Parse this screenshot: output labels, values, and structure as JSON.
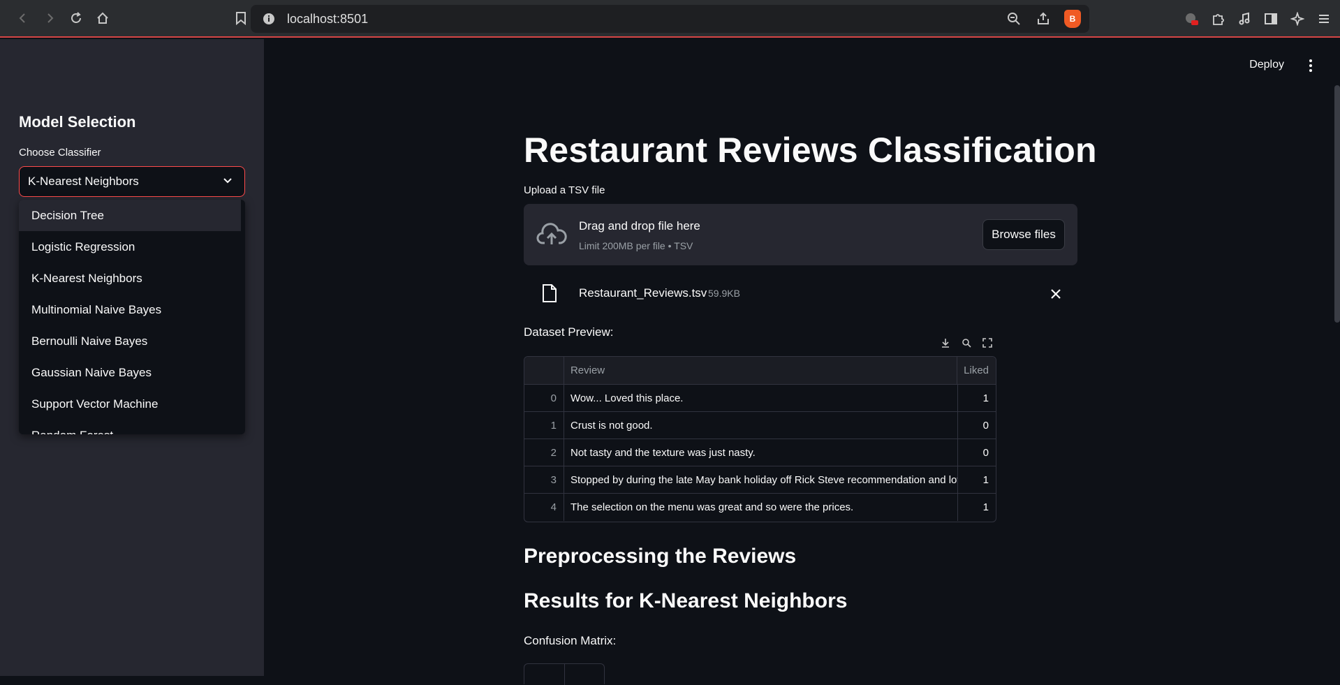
{
  "browser": {
    "url": "localhost:8501"
  },
  "sidebar": {
    "title": "Model Selection",
    "select_label": "Choose Classifier",
    "selected": "K-Nearest Neighbors",
    "options": [
      "Decision Tree",
      "Logistic Regression",
      "K-Nearest Neighbors",
      "Multinomial Naive Bayes",
      "Bernoulli Naive Bayes",
      "Gaussian Naive Bayes",
      "Support Vector Machine",
      "Random Forest"
    ]
  },
  "header": {
    "deploy_label": "Deploy"
  },
  "main": {
    "title": "Restaurant Reviews Classification",
    "upload_label": "Upload a TSV file",
    "dropzone_text": "Drag and drop file here",
    "dropzone_limit": "Limit 200MB per file • TSV",
    "browse_label": "Browse files",
    "file_name": "Restaurant_Reviews.tsv",
    "file_size": "59.9KB",
    "preview_label": "Dataset Preview:",
    "table": {
      "columns": [
        "",
        "Review",
        "Liked"
      ],
      "rows": [
        {
          "idx": "0",
          "review": "Wow... Loved this place.",
          "liked": "1"
        },
        {
          "idx": "1",
          "review": "Crust is not good.",
          "liked": "0"
        },
        {
          "idx": "2",
          "review": "Not tasty and the texture was just nasty.",
          "liked": "0"
        },
        {
          "idx": "3",
          "review": "Stopped by during the late May bank holiday off Rick Steve recommendation and love",
          "liked": "1"
        },
        {
          "idx": "4",
          "review": "The selection on the menu was great and so were the prices.",
          "liked": "1"
        }
      ]
    },
    "section_preprocess": "Preprocessing the Reviews",
    "section_results": "Results for K-Nearest Neighbors",
    "confusion_label": "Confusion Matrix:"
  },
  "colors": {
    "accent": "#ff4b4b",
    "background": "#0e1117",
    "sidebar": "#262730"
  }
}
